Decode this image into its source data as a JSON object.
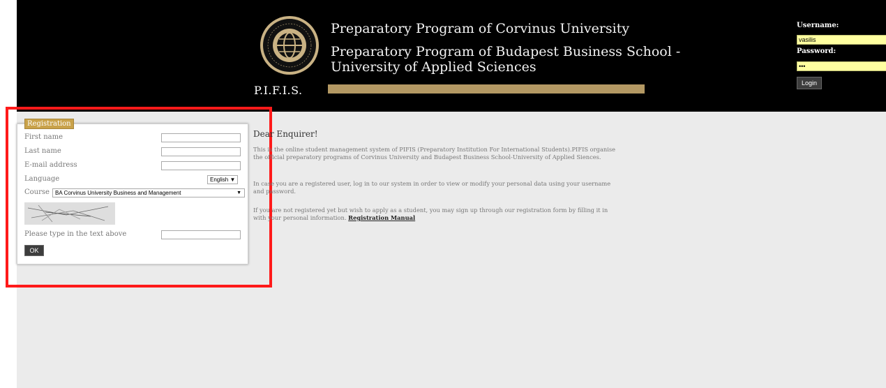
{
  "header": {
    "logo_text": "P.I.F.I.S.",
    "seal_text_top": "Preparatory Institution",
    "seal_text_bottom": "for International Students",
    "titles": [
      "Preparatory Program of Corvinus University",
      "Preparatory Program of Budapest Business School -",
      "University of Applied Sciences"
    ],
    "accent_color": "#b39863"
  },
  "login": {
    "username_label": "Username:",
    "username_value": "vasilis",
    "password_label": "Password:",
    "password_value": "•••",
    "button_label": "Login"
  },
  "registration": {
    "tab_label": "Registration",
    "fields": {
      "first_name": "First name",
      "last_name": "Last name",
      "email": "E-mail address",
      "language": "Language",
      "course": "Course",
      "captcha_prompt": "Please type in the text above"
    },
    "language_value": "English",
    "course_value": "BA Corvinus University Business and Management",
    "ok_label": "OK"
  },
  "welcome": {
    "title": "Dear Enquirer!",
    "para1": "This is the online student management system of PIFIS (Preparatory Institution For International Students).PIFIS organise the official preparatory programs of Corvinus University and Budapest Business School-University of Applied Siences.",
    "para2": "In case you are a registered user, log in to our system in order to view or modify your personal data using your username and password.",
    "para3": "If you are not registered yet but wish to apply as a student, you may sign up through our registration form by filling it in with your personal information.",
    "manual_link": "Registration Manual"
  },
  "colors": {
    "highlight": "#ff1a1a",
    "tab": "#c9a24a",
    "input_highlight": "#ffffa0"
  }
}
